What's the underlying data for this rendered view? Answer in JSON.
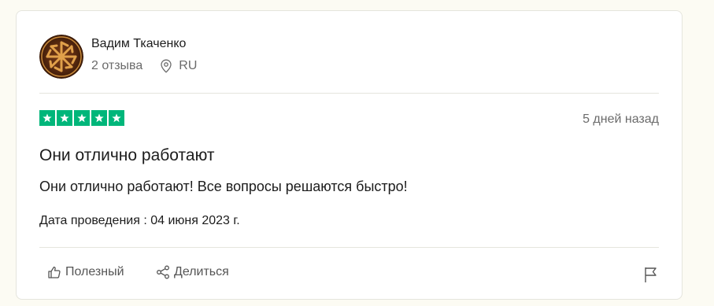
{
  "author": {
    "name": "Вадим Ткаченко",
    "reviews_count": "2 отзыва",
    "country": "RU",
    "avatar_icon": "sun-symbol-avatar"
  },
  "review": {
    "rating": 5,
    "rating_max": 5,
    "date_ago": "5 дней назад",
    "title": "Они отлично работают",
    "text": "Они отлично работают! Все вопросы решаются быстро!",
    "experience_date": "Дата проведения : 04 июня 2023 г."
  },
  "actions": {
    "useful_label": "Полезный",
    "share_label": "Делиться",
    "report_icon": "flag-icon"
  },
  "colors": {
    "star_green": "#00b67a",
    "page_background": "#fcfbf3",
    "muted_text": "#6b6b6b"
  }
}
